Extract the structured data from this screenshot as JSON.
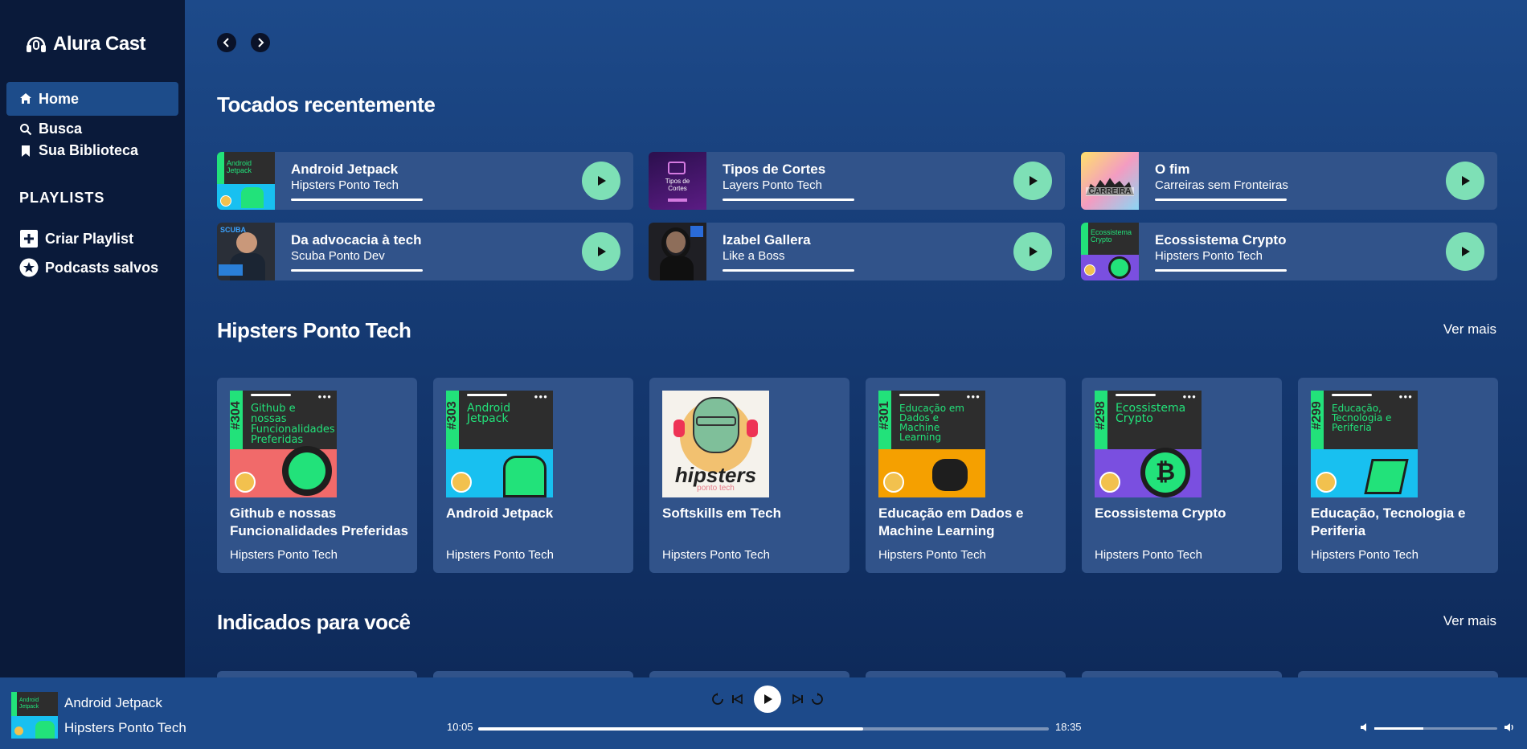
{
  "app": {
    "logo_text": "Alura Cast"
  },
  "sidebar": {
    "nav": [
      {
        "label": "Home",
        "active": true
      },
      {
        "label": "Busca"
      },
      {
        "label": "Sua Biblioteca"
      }
    ],
    "playlists_heading": "PLAYLISTS",
    "playlist_actions": [
      {
        "label": "Criar Playlist"
      },
      {
        "label": "Podcasts salvos"
      }
    ]
  },
  "recent": {
    "heading": "Tocados recentemente",
    "items": [
      {
        "title": "Android Jetpack",
        "subtitle": "Hipsters Ponto Tech"
      },
      {
        "title": "Tipos de Cortes",
        "subtitle": "Layers Ponto Tech"
      },
      {
        "title": "O fim",
        "subtitle": "Carreiras sem Fronteiras"
      },
      {
        "title": "Da advocacia à tech",
        "subtitle": "Scuba Ponto Dev"
      },
      {
        "title": "Izabel Gallera",
        "subtitle": "Like a Boss"
      },
      {
        "title": "Ecossistema Crypto",
        "subtitle": "Hipsters Ponto Tech"
      }
    ]
  },
  "hipsters": {
    "heading": "Hipsters Ponto Tech",
    "ver_mais": "Ver mais",
    "episodes": [
      {
        "title": "Github e nossas Funcionalidades Preferidas",
        "subtitle": "Hipsters Ponto Tech",
        "number": "#304",
        "cover_text": "Github e nossas Funcionalidades Preferidas",
        "color": "#f16a6a"
      },
      {
        "title": "Android Jetpack",
        "subtitle": "Hipsters Ponto Tech",
        "number": "#303",
        "cover_text": "Android Jetpack",
        "color": "#18c0f0"
      },
      {
        "title": "Softskills em Tech",
        "subtitle": "Hipsters Ponto Tech",
        "logo_text": "hipsters",
        "logo_sub": "ponto tech"
      },
      {
        "title": "Educação em Dados e Machine Learning",
        "subtitle": "Hipsters Ponto Tech",
        "number": "#301",
        "cover_text": "Educação em Dados e Machine Learning",
        "color": "#f5a000"
      },
      {
        "title": "Ecossistema Crypto",
        "subtitle": "Hipsters Ponto Tech",
        "number": "#298",
        "cover_text": "Ecossistema Crypto",
        "color": "#7a4fe0"
      },
      {
        "title": "Educação, Tecnologia e Periferia",
        "subtitle": "Hipsters Ponto Tech",
        "number": "#299",
        "cover_text": "Educação, Tecnologia e Periferia",
        "color": "#18c0f0"
      }
    ]
  },
  "indicados": {
    "heading": "Indicados para você",
    "ver_mais": "Ver mais"
  },
  "player": {
    "title": "Android Jetpack",
    "subtitle": "Hipsters Ponto Tech",
    "current_time": "10:05",
    "total_time": "18:35",
    "progress": 0.675,
    "volume": 0.4
  },
  "colors": {
    "accent": "#7ee0b6",
    "sidebar_bg": "#0a1a3a",
    "card_bg": "#31538a",
    "player_bg": "#1d4a8a"
  }
}
